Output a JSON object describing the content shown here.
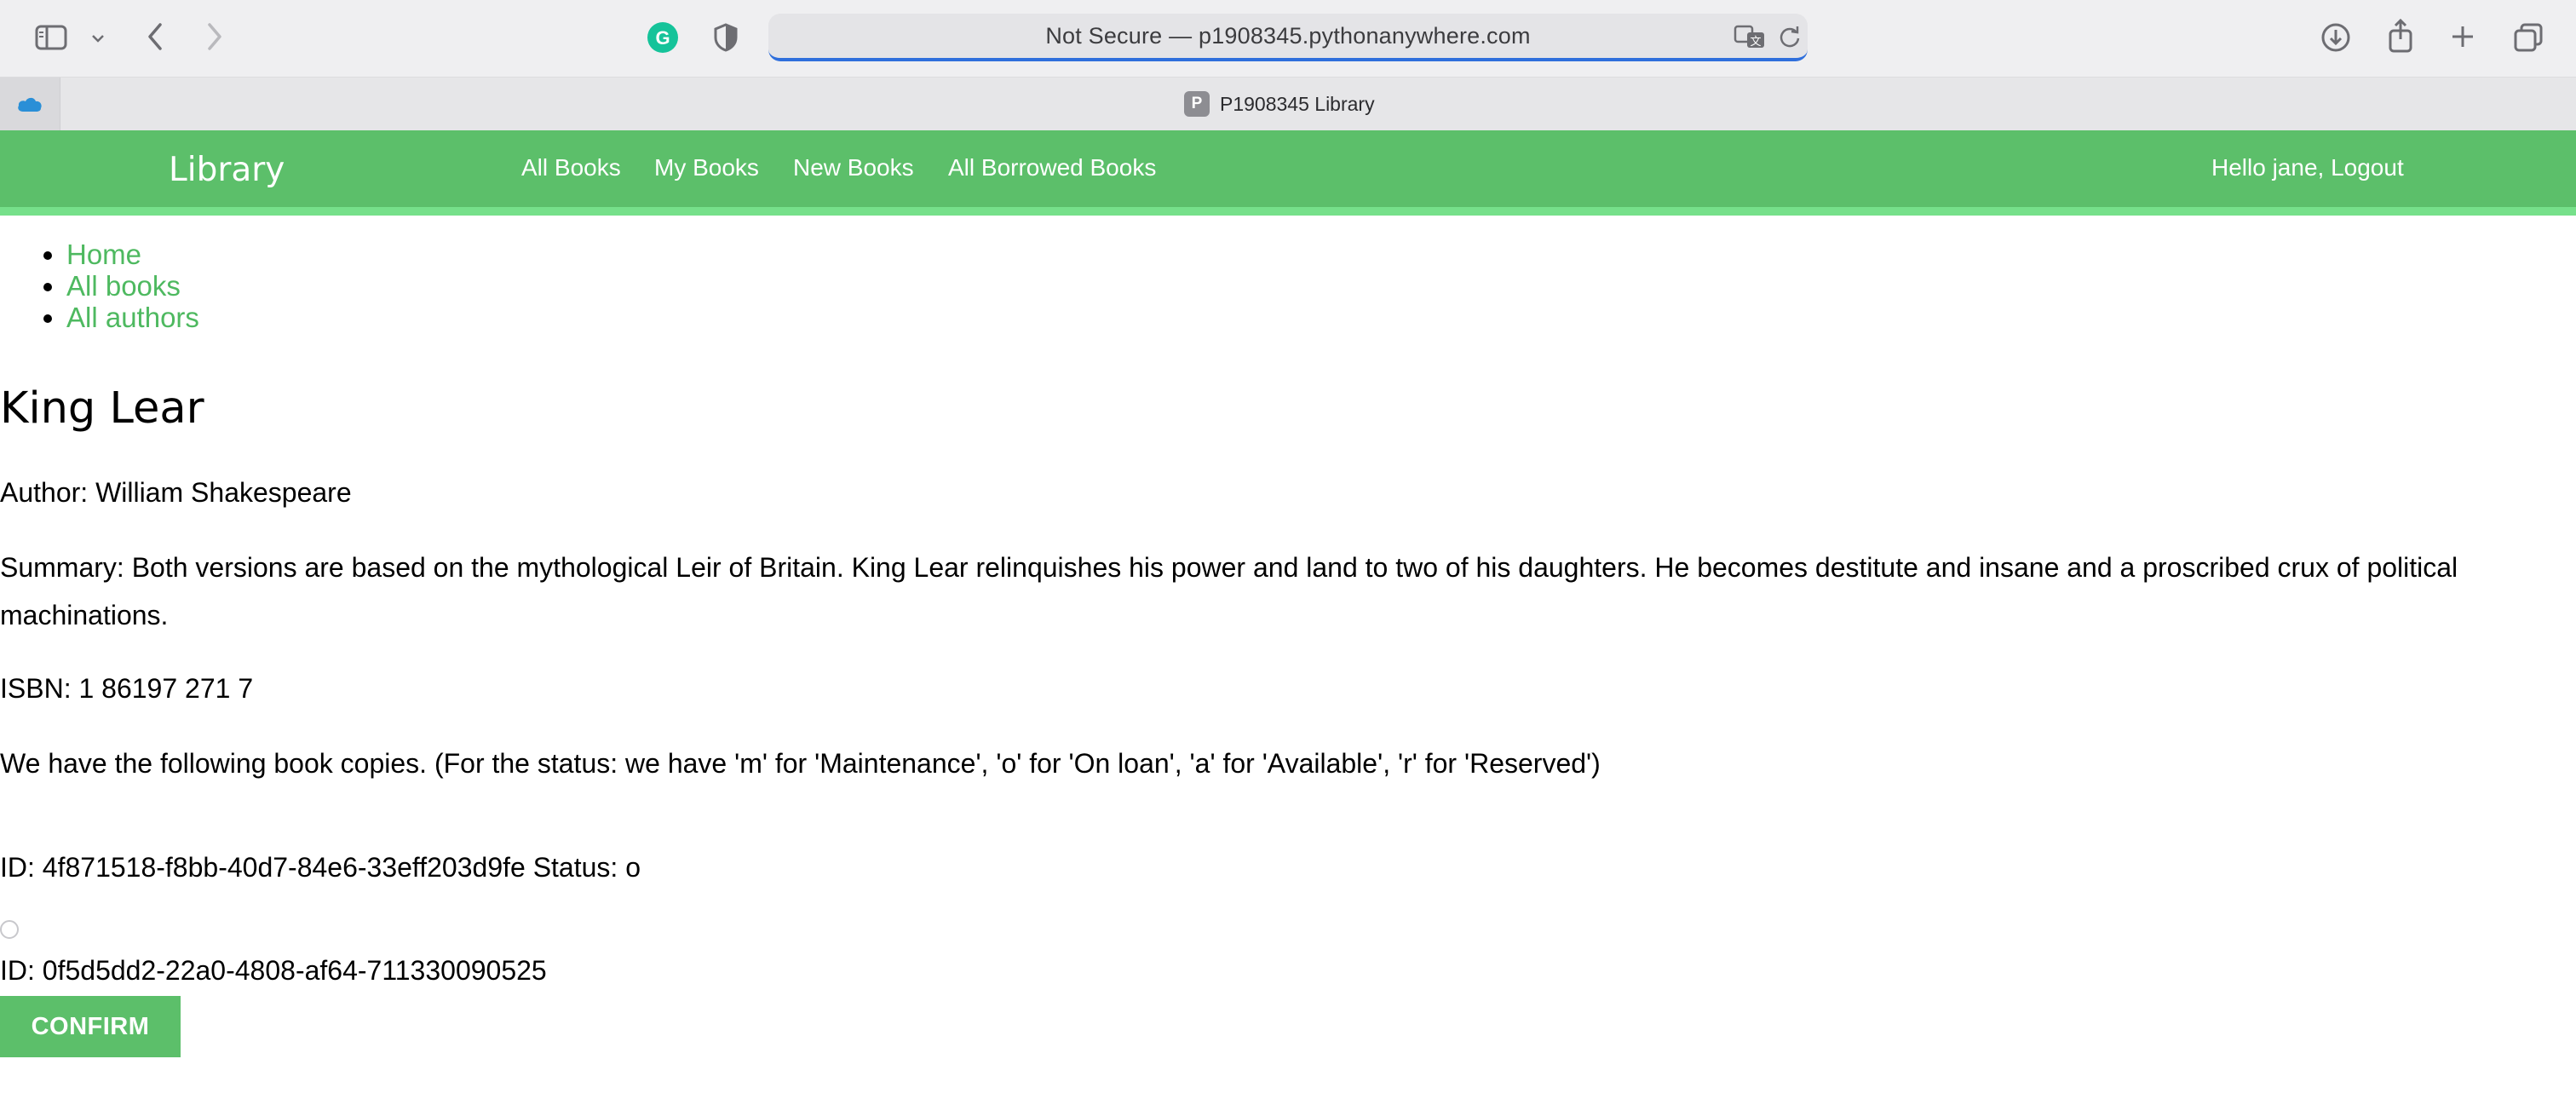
{
  "browser": {
    "address_text": "Not Secure — p1908345.pythonanywhere.com",
    "tab_title": "P1908345 Library",
    "tab_favicon_letter": "P",
    "accent_color": "#2f6fdc"
  },
  "navbar": {
    "brand": "Library",
    "links": [
      "All Books",
      "My Books",
      "New Books",
      "All Borrowed Books"
    ],
    "user_link": "Hello jane, Logout",
    "bg_color": "#5cbf6a"
  },
  "sidebar": {
    "items": [
      "Home",
      "All books",
      "All authors"
    ]
  },
  "book": {
    "title": "King Lear",
    "author_line": "Author: William Shakespeare",
    "summary_line": "Summary: Both versions are based on the mythological Leir of Britain. King Lear relinquishes his power and land to two of his daughters. He becomes destitute and insane and a proscribed crux of political machinations.",
    "isbn_line": "ISBN: 1 86197 271 7",
    "copies_intro": "We have the following book copies. (For the status: we have 'm' for 'Maintenance', 'o' for 'On loan', 'a' for 'Available', 'r' for 'Reserved')",
    "copies": [
      {
        "line": "ID: 4f871518-f8bb-40d7-84e6-33eff203d9fe Status: o"
      },
      {
        "line": "ID: 0f5d5dd2-22a0-4808-af64-711330090525"
      }
    ]
  },
  "form": {
    "confirm_label": "CONFIRM"
  },
  "icons": {
    "sidebar_toggle": "sidebar-icon",
    "back": "chevron-left-icon",
    "forward": "chevron-right-icon",
    "grammarly": "grammarly-icon",
    "privacy": "shield-icon",
    "translate": "translate-icon",
    "reload": "reload-icon",
    "downloads": "download-icon",
    "share": "share-icon",
    "new_tab": "plus-icon",
    "tab_overview": "tabs-icon"
  }
}
